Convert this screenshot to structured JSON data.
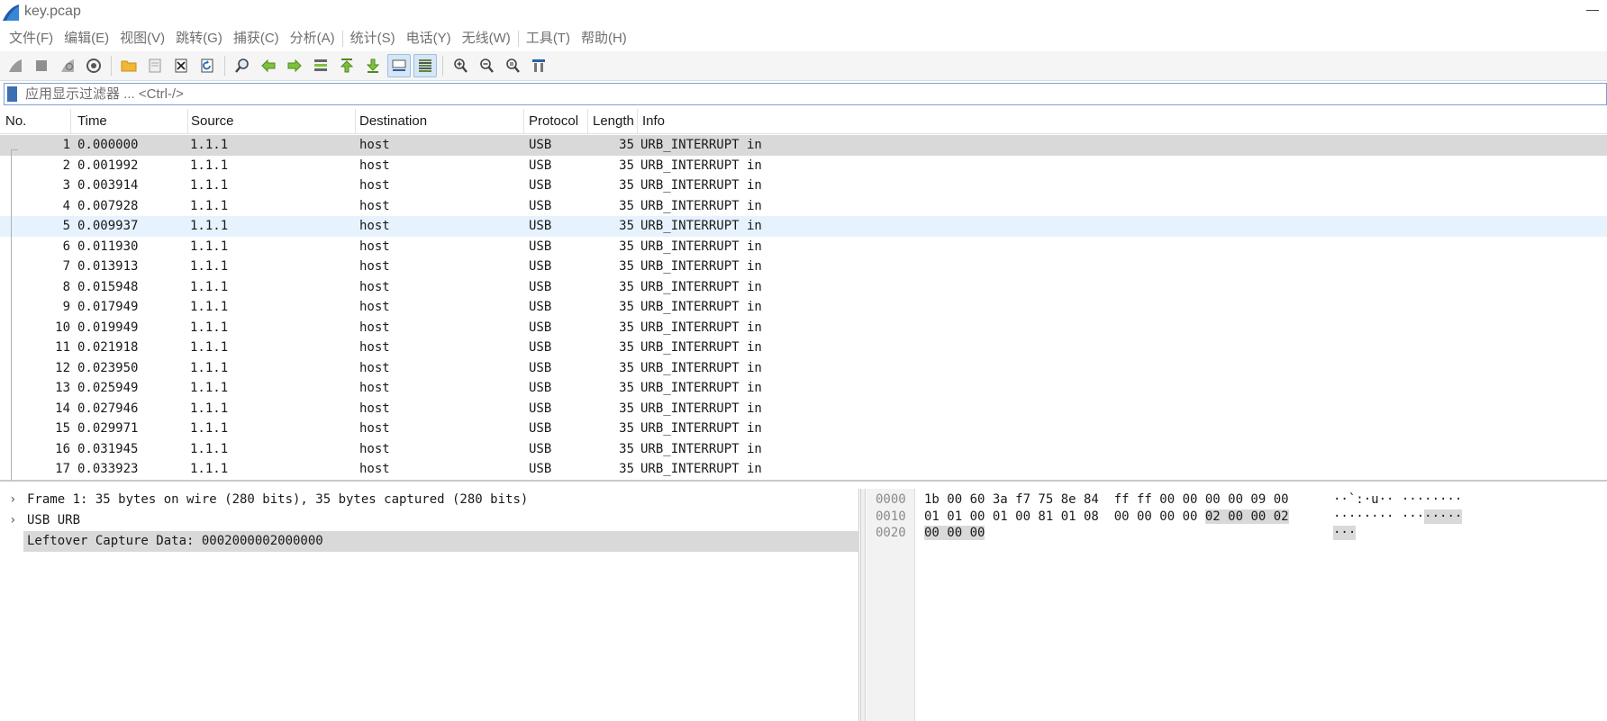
{
  "window": {
    "title": "key.pcap",
    "minimize_symbol": "—"
  },
  "menu": [
    {
      "label": "文件(F)"
    },
    {
      "label": "编辑(E)"
    },
    {
      "label": "视图(V)"
    },
    {
      "label": "跳转(G)"
    },
    {
      "label": "捕获(C)"
    },
    {
      "label": "分析(A)"
    },
    {
      "label": "统计(S)"
    },
    {
      "label": "电话(Y)"
    },
    {
      "label": "无线(W)"
    },
    {
      "label": "工具(T)"
    },
    {
      "label": "帮助(H)"
    }
  ],
  "toolbar": {
    "icons": [
      "start-capture-icon",
      "stop-capture-icon",
      "restart-capture-icon",
      "capture-options-icon",
      "open-file-icon",
      "save-file-icon",
      "close-file-icon",
      "reload-file-icon",
      "find-packet-icon",
      "go-back-icon",
      "go-forward-icon",
      "go-to-packet-icon",
      "first-packet-icon",
      "last-packet-icon",
      "autoscroll-icon",
      "colorize-icon",
      "zoom-in-icon",
      "zoom-out-icon",
      "normal-size-icon",
      "resize-columns-icon"
    ],
    "active": [
      "autoscroll-icon",
      "colorize-icon"
    ]
  },
  "filter": {
    "placeholder": "应用显示过滤器 ... <Ctrl-/>"
  },
  "columns": {
    "no": "No.",
    "time": "Time",
    "source": "Source",
    "destination": "Destination",
    "protocol": "Protocol",
    "length": "Length",
    "info": "Info"
  },
  "packets": [
    {
      "no": "1",
      "time": "0.000000",
      "src": "1.1.1",
      "dst": "host",
      "proto": "USB",
      "len": "35",
      "info": "URB_INTERRUPT in"
    },
    {
      "no": "2",
      "time": "0.001992",
      "src": "1.1.1",
      "dst": "host",
      "proto": "USB",
      "len": "35",
      "info": "URB_INTERRUPT in"
    },
    {
      "no": "3",
      "time": "0.003914",
      "src": "1.1.1",
      "dst": "host",
      "proto": "USB",
      "len": "35",
      "info": "URB_INTERRUPT in"
    },
    {
      "no": "4",
      "time": "0.007928",
      "src": "1.1.1",
      "dst": "host",
      "proto": "USB",
      "len": "35",
      "info": "URB_INTERRUPT in"
    },
    {
      "no": "5",
      "time": "0.009937",
      "src": "1.1.1",
      "dst": "host",
      "proto": "USB",
      "len": "35",
      "info": "URB_INTERRUPT in"
    },
    {
      "no": "6",
      "time": "0.011930",
      "src": "1.1.1",
      "dst": "host",
      "proto": "USB",
      "len": "35",
      "info": "URB_INTERRUPT in"
    },
    {
      "no": "7",
      "time": "0.013913",
      "src": "1.1.1",
      "dst": "host",
      "proto": "USB",
      "len": "35",
      "info": "URB_INTERRUPT in"
    },
    {
      "no": "8",
      "time": "0.015948",
      "src": "1.1.1",
      "dst": "host",
      "proto": "USB",
      "len": "35",
      "info": "URB_INTERRUPT in"
    },
    {
      "no": "9",
      "time": "0.017949",
      "src": "1.1.1",
      "dst": "host",
      "proto": "USB",
      "len": "35",
      "info": "URB_INTERRUPT in"
    },
    {
      "no": "10",
      "time": "0.019949",
      "src": "1.1.1",
      "dst": "host",
      "proto": "USB",
      "len": "35",
      "info": "URB_INTERRUPT in"
    },
    {
      "no": "11",
      "time": "0.021918",
      "src": "1.1.1",
      "dst": "host",
      "proto": "USB",
      "len": "35",
      "info": "URB_INTERRUPT in"
    },
    {
      "no": "12",
      "time": "0.023950",
      "src": "1.1.1",
      "dst": "host",
      "proto": "USB",
      "len": "35",
      "info": "URB_INTERRUPT in"
    },
    {
      "no": "13",
      "time": "0.025949",
      "src": "1.1.1",
      "dst": "host",
      "proto": "USB",
      "len": "35",
      "info": "URB_INTERRUPT in"
    },
    {
      "no": "14",
      "time": "0.027946",
      "src": "1.1.1",
      "dst": "host",
      "proto": "USB",
      "len": "35",
      "info": "URB_INTERRUPT in"
    },
    {
      "no": "15",
      "time": "0.029971",
      "src": "1.1.1",
      "dst": "host",
      "proto": "USB",
      "len": "35",
      "info": "URB_INTERRUPT in"
    },
    {
      "no": "16",
      "time": "0.031945",
      "src": "1.1.1",
      "dst": "host",
      "proto": "USB",
      "len": "35",
      "info": "URB_INTERRUPT in"
    },
    {
      "no": "17",
      "time": "0.033923",
      "src": "1.1.1",
      "dst": "host",
      "proto": "USB",
      "len": "35",
      "info": "URB_INTERRUPT in"
    }
  ],
  "selected_packet": "1",
  "hovered_packet": "5",
  "details": [
    {
      "arrow": "›",
      "text": "Frame 1: 35 bytes on wire (280 bits), 35 bytes captured (280 bits)"
    },
    {
      "arrow": "›",
      "text": "USB URB"
    },
    {
      "arrow": "",
      "text": "Leftover Capture Data: 0002000002000000"
    }
  ],
  "bytes": [
    {
      "offset": "0000",
      "hex": [
        "1b 00 60 3a f7 75 8e 84  ff ff 00 00 00 00 09 00",
        ""
      ],
      "ascii": [
        "··`:·u·· ········",
        ""
      ]
    },
    {
      "offset": "0010",
      "hex": [
        "01 01 00 01 00 81 01 08  00 00 00 00 ",
        "02 00 00 02"
      ],
      "ascii": [
        "········ ···",
        "·····"
      ]
    },
    {
      "offset": "0020",
      "hex": [
        "",
        "00 00 00"
      ],
      "ascii": [
        "",
        "···"
      ]
    }
  ],
  "colors": {
    "selected_row": "#d9d9d9",
    "hover_row": "#e6f2fd",
    "filter_border": "#7aa1d2",
    "bookmark": "#3d6fb3"
  }
}
